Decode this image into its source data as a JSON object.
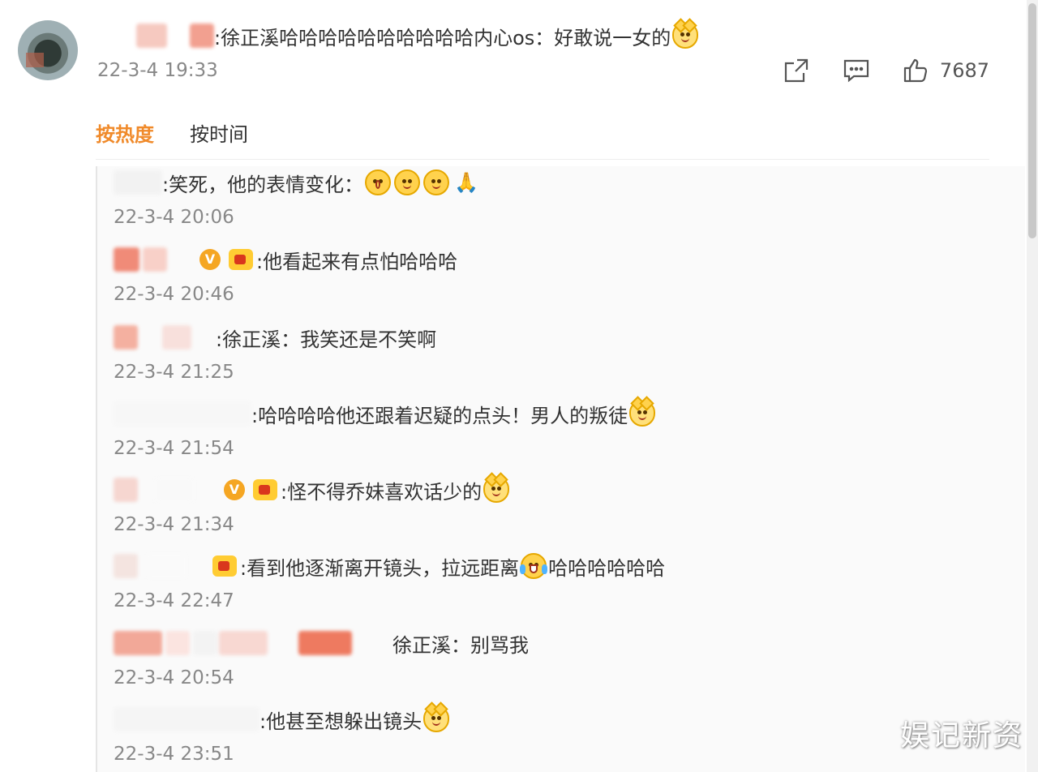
{
  "post": {
    "text": ":徐正溪哈哈哈哈哈哈哈哈哈哈内心os：好敢说一女的",
    "time": "22-3-4 19:33",
    "like_count": "7687"
  },
  "tabs": {
    "hot": "按热度",
    "time": "按时间"
  },
  "replies": [
    {
      "text": ":笑死，他的表情变化：",
      "time": "22-3-4 20:06"
    },
    {
      "text": ":他看起来有点怕哈哈哈",
      "time": "22-3-4 20:46"
    },
    {
      "text": ":徐正溪：我笑还是不笑啊",
      "time": "22-3-4 21:25"
    },
    {
      "text": ":哈哈哈哈他还跟着迟疑的点头！男人的叛徒",
      "time": "22-3-4 21:54"
    },
    {
      "text": ":怪不得乔妹喜欢话少的",
      "time": "22-3-4 21:34"
    },
    {
      "text_a": ":看到他逐渐离开镜头，拉远距离",
      "text_b": "哈哈哈哈哈哈",
      "time": "22-3-4 22:47"
    },
    {
      "text": "徐正溪：别骂我",
      "time": "22-3-4 20:54"
    },
    {
      "text": ":他甚至想躲出镜头",
      "time": "22-3-4 23:51"
    }
  ],
  "icons": {
    "share": "share-icon",
    "comment": "comment-icon",
    "like": "thumbs-up-icon",
    "vip": "vip-badge-icon",
    "doge": "doge-emoji",
    "laugh_cry": "laughing-crying-emoji"
  },
  "colors": {
    "accent": "#f08a2a",
    "meta": "#888888"
  },
  "watermark": "娱记新资"
}
